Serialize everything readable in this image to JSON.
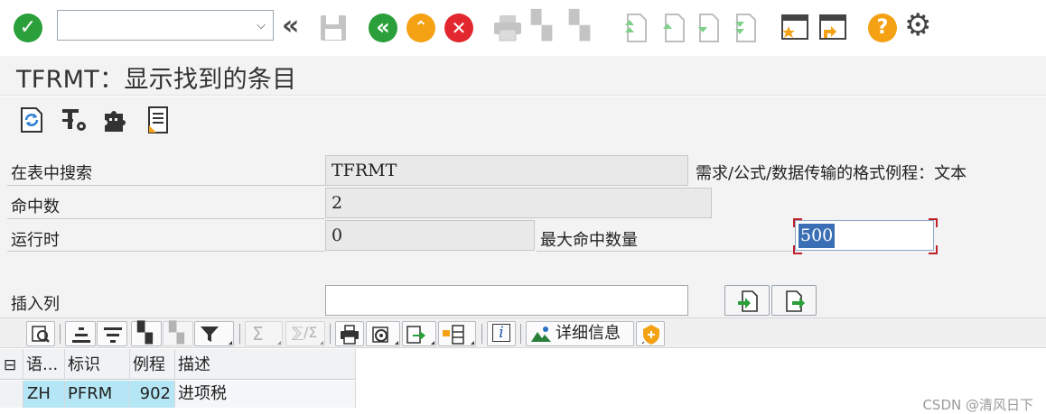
{
  "toolbar": {
    "command_field_value": "",
    "icons": [
      "check-icon",
      "back-double-icon",
      "save-icon",
      "back-icon",
      "exit-icon",
      "cancel-icon",
      "print-icon",
      "find-icon",
      "find-next-icon",
      "first-page-icon",
      "previous-page-icon",
      "next-page-icon",
      "last-page-icon",
      "new-session-icon",
      "create-shortcut-icon",
      "help-icon",
      "settings-icon"
    ]
  },
  "title": "TFRMT：显示找到的条目",
  "app_toolbar": {
    "icons": [
      "refresh-icon",
      "table-settings-icon",
      "puzzle-icon",
      "notes-icon"
    ]
  },
  "form": {
    "search_in_table_label": "在表中搜索",
    "search_in_table_value": "TFRMT",
    "table_description": "需求/公式/数据传输的格式例程：文本",
    "hits_label": "命中数",
    "hits_value": "2",
    "runtime_label": "运行时",
    "runtime_value": "0",
    "max_hits_label": "最大命中数量",
    "max_hits_value": "500",
    "insert_column_label": "插入列",
    "insert_column_value": ""
  },
  "alv_toolbar": {
    "details_label": "详细信息",
    "icons": [
      "details-icon",
      "sort-ascending-icon",
      "sort-descending-icon",
      "find-icon",
      "find-next-icon",
      "filter-icon",
      "sum-icon",
      "subtotal-icon",
      "print-icon",
      "views-icon",
      "export-icon",
      "layout-icon",
      "info-icon",
      "graphic-icon",
      "abc-analysis-icon"
    ]
  },
  "grid": {
    "columns": [
      "语...",
      "标识",
      "例程",
      "描述"
    ],
    "rows": [
      {
        "lang": "ZH",
        "id": "PFRM",
        "routine": "902",
        "desc": "进项税"
      }
    ]
  },
  "watermark": "CSDN @清风日下",
  "colors": {
    "green": "#2a9f3a",
    "orange": "#f4a214",
    "red": "#e2282e",
    "key_cell": "#b4e6f5",
    "selection": "#3b6fb5"
  }
}
